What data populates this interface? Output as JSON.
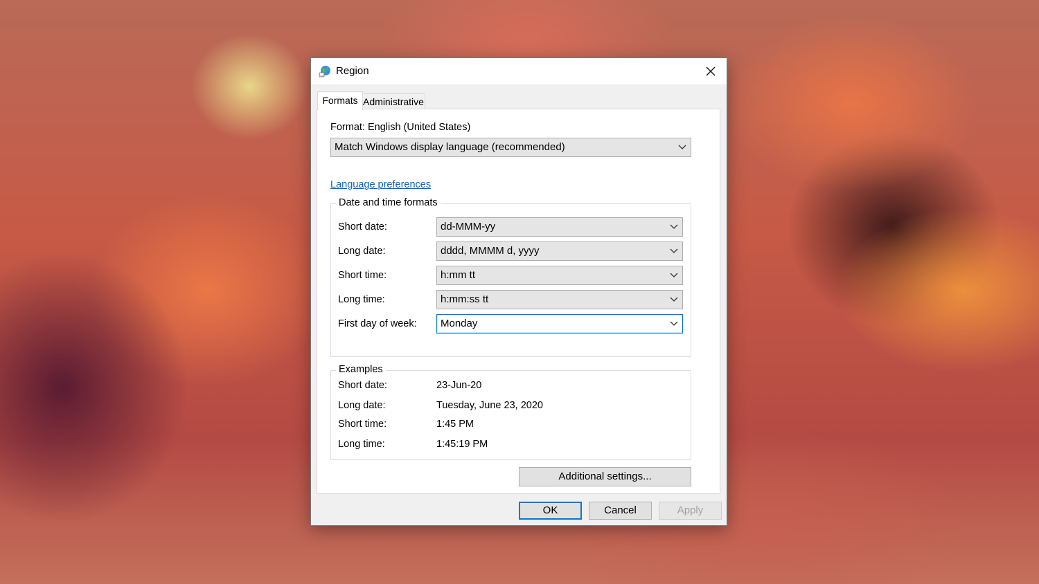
{
  "window": {
    "title": "Region",
    "close_icon": "close-icon"
  },
  "tabs": [
    {
      "label": "Formats",
      "active": true
    },
    {
      "label": "Administrative",
      "active": false
    }
  ],
  "format": {
    "label": "Format: English (United States)",
    "selected": "Match Windows display language (recommended)"
  },
  "language_link": "Language preferences",
  "date_time_formats": {
    "legend": "Date and time formats",
    "rows": [
      {
        "label": "Short date:",
        "value": "dd-MMM-yy"
      },
      {
        "label": "Long date:",
        "value": "dddd, MMMM d, yyyy"
      },
      {
        "label": "Short time:",
        "value": "h:mm tt"
      },
      {
        "label": "Long time:",
        "value": "h:mm:ss tt"
      },
      {
        "label": "First day of week:",
        "value": "Monday"
      }
    ]
  },
  "examples": {
    "legend": "Examples",
    "rows": [
      {
        "label": "Short date:",
        "value": "23-Jun-20"
      },
      {
        "label": "Long date:",
        "value": "Tuesday, June 23, 2020"
      },
      {
        "label": "Short time:",
        "value": "1:45 PM"
      },
      {
        "label": "Long time:",
        "value": "1:45:19 PM"
      }
    ]
  },
  "buttons": {
    "additional": "Additional settings...",
    "ok": "OK",
    "cancel": "Cancel",
    "apply": "Apply"
  },
  "colors": {
    "accent": "#0078d7",
    "link": "#0066cc"
  }
}
